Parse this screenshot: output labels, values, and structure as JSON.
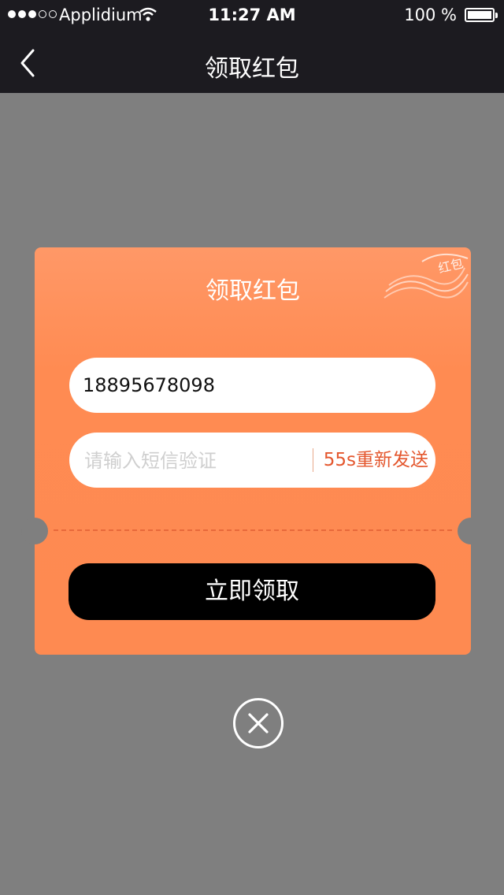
{
  "status_bar": {
    "carrier": "Applidium",
    "time": "11:27 AM",
    "battery": "100 %"
  },
  "nav": {
    "title": "领取红包"
  },
  "card": {
    "title": "领取红包",
    "stamp_text": "红包",
    "phone_value": "18895678098",
    "code_placeholder": "请输入短信验证",
    "resend_label": "55s重新发送",
    "claim_label": "立即领取"
  },
  "colors": {
    "card_orange": "#ff8b52",
    "resend_red": "#e4572e",
    "overlay_gray": "#7f7f7f",
    "bar_dark": "#1c1b20"
  },
  "icons": {
    "back": "chevron-left-icon",
    "close": "close-circle-icon",
    "wifi": "wifi-icon"
  }
}
